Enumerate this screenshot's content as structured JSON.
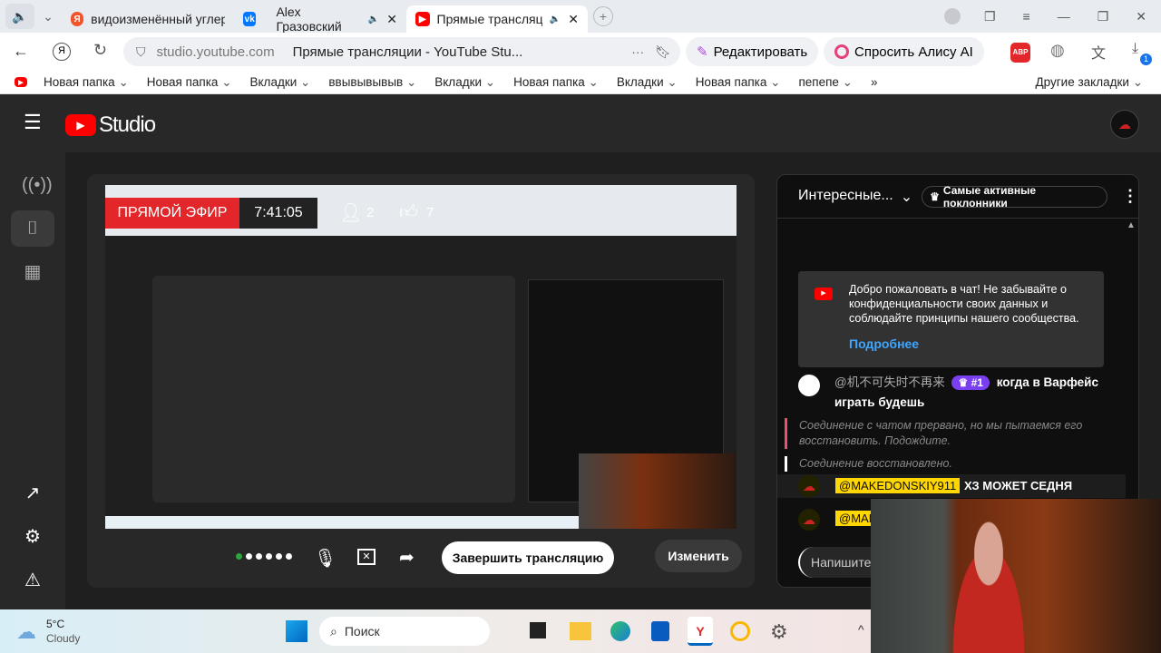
{
  "browser": {
    "tabs": [
      {
        "label": "видоизменённый углерод"
      },
      {
        "label": "Alex Гразовский"
      },
      {
        "label": "Прямые трансляции"
      }
    ],
    "url": "studio.youtube.com",
    "page_title": "Прямые трансляции - YouTube Stu...",
    "edit_label": "Редактировать",
    "alice_label": "Спросить Алису AI",
    "abp": "ABP",
    "downloads_badge": "1",
    "bookmarks": [
      "Новая папка",
      "Новая папка",
      "Вкладки",
      "ввывывывыв",
      "Вкладки",
      "Новая папка",
      "Вкладки",
      "Новая папка",
      "пепепе"
    ],
    "more_bookmarks": "»",
    "other_bookmarks": "Другие закладки"
  },
  "studio": {
    "logo": "Studio"
  },
  "stream": {
    "live_label": "ПРЯМОЙ ЭФИР",
    "duration": "7:41:05",
    "viewers": "2",
    "likes": "7",
    "end_button": "Завершить трансляцию",
    "edit_button": "Изменить"
  },
  "chat": {
    "mode": "Интересные...",
    "top_fans": "Самые активные поклонники",
    "welcome": "Добро пожаловать в чат! Не забывайте о конфиденциальности своих данных и соблюдайте принципы нашего сообщества.",
    "more": "Подробнее",
    "messages": [
      {
        "author": "@机不可失时不再来",
        "badge": "#1",
        "text": "когда в Варфейс играть будешь"
      },
      {
        "author": "@MAKEDONSKIY911",
        "text": "ХЗ МОЖЕТ СЕДНЯ"
      },
      {
        "author": "@MAK"
      }
    ],
    "system": [
      "Соединение с чатом прервано, но мы пытаемся его восстановить. Подождите.",
      "Соединение восстановлено."
    ],
    "input_placeholder": "Напишите"
  },
  "taskbar": {
    "temp": "5°C",
    "weather": "Cloudy",
    "search": "Поиск"
  },
  "colors": {
    "youtube_red": "#ff0000",
    "accent_blue": "#3ea6ff",
    "badge_purple": "#7b3ff2",
    "mention_yellow": "#ffd600"
  }
}
